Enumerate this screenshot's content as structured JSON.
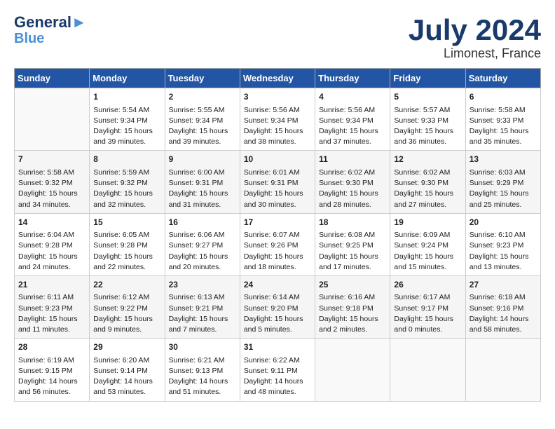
{
  "header": {
    "logo_line1": "General",
    "logo_line2": "Blue",
    "month": "July 2024",
    "location": "Limonest, France"
  },
  "days_of_week": [
    "Sunday",
    "Monday",
    "Tuesday",
    "Wednesday",
    "Thursday",
    "Friday",
    "Saturday"
  ],
  "weeks": [
    [
      {
        "day": "",
        "content": ""
      },
      {
        "day": "1",
        "content": "Sunrise: 5:54 AM\nSunset: 9:34 PM\nDaylight: 15 hours\nand 39 minutes."
      },
      {
        "day": "2",
        "content": "Sunrise: 5:55 AM\nSunset: 9:34 PM\nDaylight: 15 hours\nand 39 minutes."
      },
      {
        "day": "3",
        "content": "Sunrise: 5:56 AM\nSunset: 9:34 PM\nDaylight: 15 hours\nand 38 minutes."
      },
      {
        "day": "4",
        "content": "Sunrise: 5:56 AM\nSunset: 9:34 PM\nDaylight: 15 hours\nand 37 minutes."
      },
      {
        "day": "5",
        "content": "Sunrise: 5:57 AM\nSunset: 9:33 PM\nDaylight: 15 hours\nand 36 minutes."
      },
      {
        "day": "6",
        "content": "Sunrise: 5:58 AM\nSunset: 9:33 PM\nDaylight: 15 hours\nand 35 minutes."
      }
    ],
    [
      {
        "day": "7",
        "content": "Sunrise: 5:58 AM\nSunset: 9:32 PM\nDaylight: 15 hours\nand 34 minutes."
      },
      {
        "day": "8",
        "content": "Sunrise: 5:59 AM\nSunset: 9:32 PM\nDaylight: 15 hours\nand 32 minutes."
      },
      {
        "day": "9",
        "content": "Sunrise: 6:00 AM\nSunset: 9:31 PM\nDaylight: 15 hours\nand 31 minutes."
      },
      {
        "day": "10",
        "content": "Sunrise: 6:01 AM\nSunset: 9:31 PM\nDaylight: 15 hours\nand 30 minutes."
      },
      {
        "day": "11",
        "content": "Sunrise: 6:02 AM\nSunset: 9:30 PM\nDaylight: 15 hours\nand 28 minutes."
      },
      {
        "day": "12",
        "content": "Sunrise: 6:02 AM\nSunset: 9:30 PM\nDaylight: 15 hours\nand 27 minutes."
      },
      {
        "day": "13",
        "content": "Sunrise: 6:03 AM\nSunset: 9:29 PM\nDaylight: 15 hours\nand 25 minutes."
      }
    ],
    [
      {
        "day": "14",
        "content": "Sunrise: 6:04 AM\nSunset: 9:28 PM\nDaylight: 15 hours\nand 24 minutes."
      },
      {
        "day": "15",
        "content": "Sunrise: 6:05 AM\nSunset: 9:28 PM\nDaylight: 15 hours\nand 22 minutes."
      },
      {
        "day": "16",
        "content": "Sunrise: 6:06 AM\nSunset: 9:27 PM\nDaylight: 15 hours\nand 20 minutes."
      },
      {
        "day": "17",
        "content": "Sunrise: 6:07 AM\nSunset: 9:26 PM\nDaylight: 15 hours\nand 18 minutes."
      },
      {
        "day": "18",
        "content": "Sunrise: 6:08 AM\nSunset: 9:25 PM\nDaylight: 15 hours\nand 17 minutes."
      },
      {
        "day": "19",
        "content": "Sunrise: 6:09 AM\nSunset: 9:24 PM\nDaylight: 15 hours\nand 15 minutes."
      },
      {
        "day": "20",
        "content": "Sunrise: 6:10 AM\nSunset: 9:23 PM\nDaylight: 15 hours\nand 13 minutes."
      }
    ],
    [
      {
        "day": "21",
        "content": "Sunrise: 6:11 AM\nSunset: 9:23 PM\nDaylight: 15 hours\nand 11 minutes."
      },
      {
        "day": "22",
        "content": "Sunrise: 6:12 AM\nSunset: 9:22 PM\nDaylight: 15 hours\nand 9 minutes."
      },
      {
        "day": "23",
        "content": "Sunrise: 6:13 AM\nSunset: 9:21 PM\nDaylight: 15 hours\nand 7 minutes."
      },
      {
        "day": "24",
        "content": "Sunrise: 6:14 AM\nSunset: 9:20 PM\nDaylight: 15 hours\nand 5 minutes."
      },
      {
        "day": "25",
        "content": "Sunrise: 6:16 AM\nSunset: 9:18 PM\nDaylight: 15 hours\nand 2 minutes."
      },
      {
        "day": "26",
        "content": "Sunrise: 6:17 AM\nSunset: 9:17 PM\nDaylight: 15 hours\nand 0 minutes."
      },
      {
        "day": "27",
        "content": "Sunrise: 6:18 AM\nSunset: 9:16 PM\nDaylight: 14 hours\nand 58 minutes."
      }
    ],
    [
      {
        "day": "28",
        "content": "Sunrise: 6:19 AM\nSunset: 9:15 PM\nDaylight: 14 hours\nand 56 minutes."
      },
      {
        "day": "29",
        "content": "Sunrise: 6:20 AM\nSunset: 9:14 PM\nDaylight: 14 hours\nand 53 minutes."
      },
      {
        "day": "30",
        "content": "Sunrise: 6:21 AM\nSunset: 9:13 PM\nDaylight: 14 hours\nand 51 minutes."
      },
      {
        "day": "31",
        "content": "Sunrise: 6:22 AM\nSunset: 9:11 PM\nDaylight: 14 hours\nand 48 minutes."
      },
      {
        "day": "",
        "content": ""
      },
      {
        "day": "",
        "content": ""
      },
      {
        "day": "",
        "content": ""
      }
    ]
  ]
}
